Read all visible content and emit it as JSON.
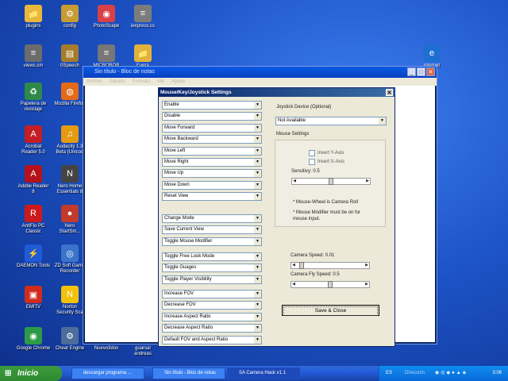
{
  "desktop_icons": [
    {
      "label": "plugins",
      "glyph": "📁",
      "color": "#e8b83a"
    },
    {
      "label": "config",
      "glyph": "⚙",
      "color": "#c99b35"
    },
    {
      "label": "PhotoScape",
      "glyph": "◉",
      "color": "#d8404a"
    },
    {
      "label": "iexpress.cs",
      "glyph": "≡",
      "color": "#7c7c7c"
    },
    {
      "label": "views.cm",
      "glyph": "≡",
      "color": "#6c6c6c"
    },
    {
      "label": "0Speech",
      "glyph": "▤",
      "color": "#a67c2a"
    },
    {
      "label": "MICROBOB",
      "glyph": "≡",
      "color": "#777777"
    },
    {
      "label": "Papelera de\nreciclaje",
      "glyph": "♻",
      "color": "#2f8a4a"
    },
    {
      "label": "Mozilla Firefox",
      "glyph": "◍",
      "color": "#e36a16"
    },
    {
      "label": "Acrobat\nReader 5.0",
      "glyph": "A",
      "color": "#c41e24"
    },
    {
      "label": "Audacity 1.3\nBeta (Unicod",
      "glyph": "♫",
      "color": "#e59a10"
    },
    {
      "label": "Adobe Reader\n8",
      "glyph": "A",
      "color": "#b5121b"
    },
    {
      "label": "Nero Home\nEssentials 8",
      "glyph": "N",
      "color": "#444444"
    },
    {
      "label": "AntiFlo PC\nClassic",
      "glyph": "R",
      "color": "#cc1a1a"
    },
    {
      "label": "Nero\nStartSm...",
      "glyph": "●",
      "color": "#c23a2a"
    },
    {
      "label": "DAEMON Tools",
      "glyph": "⚡",
      "color": "#1f5bd6"
    },
    {
      "label": "ZD Soft Game\nRecorder",
      "glyph": "◎",
      "color": "#3a73c9"
    },
    {
      "label": "EMITV",
      "glyph": "▣",
      "color": "#d12b1e"
    },
    {
      "label": "Norton\nSecurity Sca",
      "glyph": "N",
      "color": "#f2c20b"
    },
    {
      "label": "Google Chrome",
      "glyph": "◉",
      "color": "#2e9a47"
    },
    {
      "label": "Cheat Engine",
      "glyph": "⚙",
      "color": "#4d6d9c"
    },
    {
      "label": "Nuevo3dox",
      "glyph": "",
      "color": "transparent"
    },
    {
      "label": "guarsal\nandreas",
      "glyph": "",
      "color": "transparent"
    },
    {
      "label": "internet",
      "glyph": "e",
      "color": "#1f6fd3"
    },
    {
      "label": "Fuera",
      "glyph": "📁",
      "color": "#e0b23a"
    }
  ],
  "notepad": {
    "title": "Sin título - Bloc de notas",
    "menu": [
      "Archivo",
      "Edición",
      "Formato",
      "Ver",
      "Ayuda"
    ],
    "minimize": "_",
    "maximize": "□",
    "close": "✕"
  },
  "dialog": {
    "title": "Mouse/Key/Joystick Settings",
    "close": "✕",
    "combos_group1": [
      "Enable",
      "Disable",
      "Move Forward",
      "Move Backward",
      "Move Left",
      "Move Right",
      "Move Up",
      "Move Down",
      "Reset View"
    ],
    "combos_group2": [
      "Change Mode",
      "Save Current View",
      "Toggle Mouse Modifier"
    ],
    "combos_group3": [
      "Toggle Free Look Mode",
      "Toggle Guages",
      "Toggle Player Visibility"
    ],
    "combos_group4": [
      "Increase FOV",
      "Decrease FOV",
      "Increase Aspect Ratio",
      "Decrease Aspect Ratio",
      "Default FOV and Aspect Ratio"
    ],
    "joystick_label": "Joystick Device (Optional)",
    "joystick_value": "Not Available",
    "mouse_settings_label": "Mouse Settings",
    "invert_y": "Invert Y-Axis",
    "invert_x": "Invert X-Axis",
    "sensitivity": "Sensitivy: 0.5",
    "sensitivity_level": 0.5,
    "note1": "* Mouse-Wheel is Camera Roll",
    "note2": "* Mouse Modifier must be on for\nmouse input.",
    "camera_speed": "Camera Speed: 0.01",
    "camera_speed_level": 0.05,
    "camera_fly_speed": "Camera Fly Speed: 0.5",
    "camera_fly_level": 0.5,
    "save_close": "Save & Close"
  },
  "taskbar": {
    "start": "Inicio",
    "tasks": [
      "descargar programa ...",
      "Sin título - Bloc de notas",
      "SA Camera Hack v1.1"
    ],
    "lang": "ES",
    "tray_label": "Dirección",
    "clock": "3:06"
  }
}
